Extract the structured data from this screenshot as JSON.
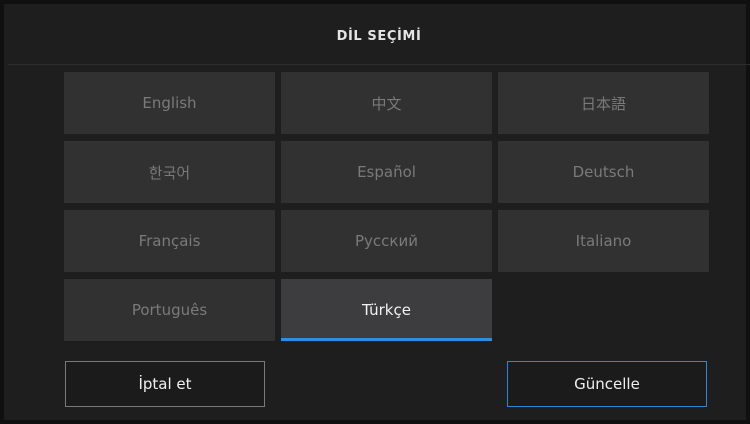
{
  "dialog": {
    "title": "DİL SEÇİMİ"
  },
  "languages": [
    {
      "label": "English",
      "selected": false
    },
    {
      "label": "中文",
      "selected": false
    },
    {
      "label": "日本語",
      "selected": false
    },
    {
      "label": "한국어",
      "selected": false
    },
    {
      "label": "Español",
      "selected": false
    },
    {
      "label": "Deutsch",
      "selected": false
    },
    {
      "label": "Français",
      "selected": false
    },
    {
      "label": "Русский",
      "selected": false
    },
    {
      "label": "Italiano",
      "selected": false
    },
    {
      "label": "Português",
      "selected": false
    },
    {
      "label": "Türkçe",
      "selected": true
    }
  ],
  "buttons": {
    "cancel_label": "İptal et",
    "update_label": "Güncelle"
  },
  "colors": {
    "accent": "#2e8ee0",
    "background": "#1e1e1e",
    "tile": "#313131",
    "tile_selected": "#3d3d3f"
  }
}
